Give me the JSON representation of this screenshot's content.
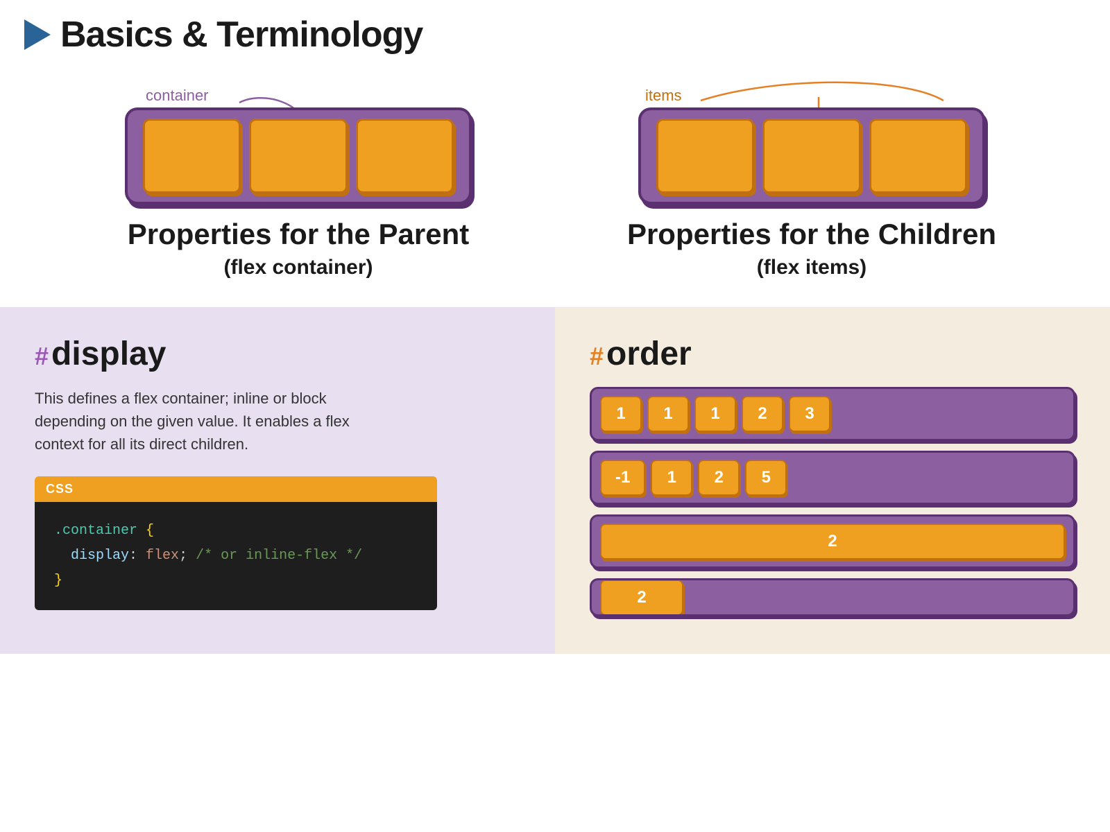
{
  "header": {
    "title": "Basics & Terminology"
  },
  "diagrams": {
    "left": {
      "label": "container",
      "title": "Properties for the Parent",
      "subtitle": "(flex container)"
    },
    "right": {
      "label": "items",
      "title": "Properties for the Children",
      "subtitle": "(flex items)"
    }
  },
  "left_panel": {
    "hash": "#",
    "property_name": "display",
    "description": "This defines a flex container; inline or block depending on the given value. It enables a flex context for all its direct children.",
    "code_header": "CSS",
    "code_lines": [
      ".container {",
      "  display: flex; /* or inline-flex */",
      "}"
    ]
  },
  "right_panel": {
    "hash": "#",
    "property_name": "order",
    "rows": [
      {
        "items": [
          "1",
          "1",
          "1",
          "2",
          "3"
        ],
        "has_dash": false
      },
      {
        "items": [
          "-1",
          "1",
          "2",
          "5"
        ],
        "has_dash": true
      },
      {
        "items": [
          "2"
        ],
        "is_wide": true,
        "has_dash": false
      },
      {
        "items": [
          "2"
        ],
        "is_wide": false,
        "partial": true
      }
    ]
  }
}
